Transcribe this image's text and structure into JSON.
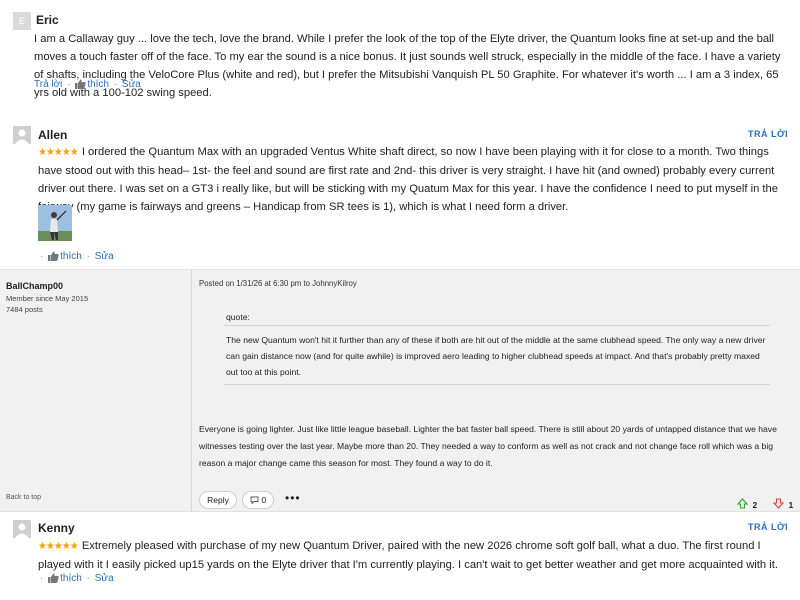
{
  "comments": [
    {
      "avatar_letter": "E",
      "author": "Eric",
      "text": "I am a Callaway guy ... love the tech, love the brand. While I prefer the look of the top of the Elyte driver, the Quantum looks fine at set-up and the ball moves a touch faster off of the face. To my ear the sound is a nice bonus. It just sounds well struck, especially in the middle of the face. I have a variety of shafts, including the VeloCore Plus (white and red), but I prefer the Mitsubishi Vanquish PL 50 Graphite. For whatever it's worth ... I am a 3 index, 65 yrs old with a 100-102 swing speed.",
      "actions": {
        "reply": "Trả lời",
        "like": "thích",
        "edit": "Sửa"
      }
    },
    {
      "author": "Allen",
      "reply_label": "Trả lời",
      "stars": "★★★★★",
      "text": "I ordered the Quantum Max with an upgraded Ventus White shaft direct, so now I have been playing with it for close to a month. Two things have stood out with this head– 1st- the feel and sound are first rate and 2nd- this driver is very straight. I have hit (and owned) probably every current driver out there. I was set on a GT3 i really like, but will be sticking with my Quatum Max for this year. I have the confidence I need to put myself in the fairway (my game is fairways and greens – Handicap from SR tees is 1), which is what I need form a driver.",
      "actions": {
        "like": "thích",
        "edit": "Sửa"
      }
    },
    {
      "author": "Kenny",
      "reply_label": "Trả lời",
      "stars": "★★★★★",
      "text": "Extremely pleased with purchase of my new Quantum Driver, paired with the new 2026 chrome soft golf ball, what a duo. The first round I played with it I easily picked up15 yards on the Elyte driver that I'm currently playing. I can't wait to get better weather and get more acquainted with it.",
      "actions": {
        "like": "thích",
        "edit": "Sửa"
      }
    }
  ],
  "forum_post": {
    "username": "BallChamp00",
    "member_since": "Member since May 2015",
    "posts": "7484 posts",
    "posted": "Posted on 1/31/26 at 6:30 pm to JohnnyKilroy",
    "quote_label": "quote:",
    "quote_text": "The new Quantum won't hit it further than any of these if both are hit out of the middle at the same clubhead speed. The only way a new driver can gain distance now (and for quite awhile) is improved aero leading to higher clubhead speeds at impact. And that's probably pretty maxed out too at this point.",
    "body": "Everyone is going lighter. Just like little league baseball. Lighter the bat faster ball speed. There is still about 20 yards of untapped distance that we have witnesses testing over the last year. Maybe more than 20. They needed a way to conform as well as not crack and not change face roll which was a big reason a major change came this season for most. They found a way to do it.",
    "back_to_top": "Back to top",
    "reply_button": "Reply",
    "comment_count": "0",
    "more": "•••",
    "upvotes": "2",
    "downvotes": "1"
  },
  "colors": {
    "link": "#2a6ebb",
    "star": "#f4a300",
    "upvote": "#2aa52a",
    "downvote": "#d24545"
  },
  "icons": [
    "thumbs-up-icon",
    "comment-bubble-icon",
    "up-arrow-icon",
    "down-arrow-icon",
    "more-icon"
  ]
}
